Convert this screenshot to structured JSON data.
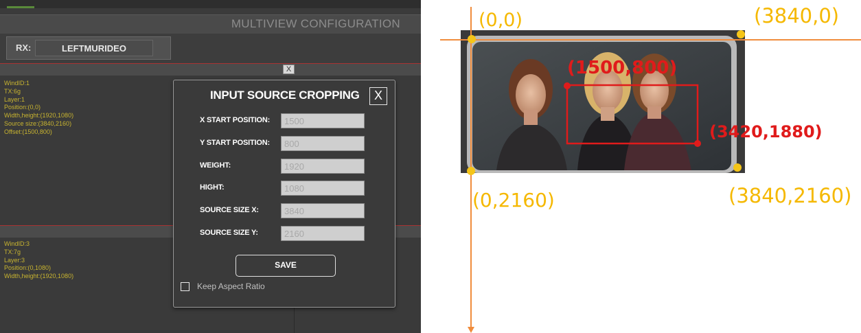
{
  "app": {
    "title": "MULTIVIEW CONFIGURATION",
    "rx_label": "RX:",
    "rx_value": "LEFTMURIDEO",
    "window_close_label": "X",
    "window1": {
      "lines": [
        "WindID:1",
        "TX:6g",
        "Layer:1",
        "Position:(0,0)",
        "Width,height:(1920,1080)",
        "Source size:(3840,2160)",
        "Offset:(1500,800)"
      ]
    },
    "window2": {
      "lines": [
        "WindID:3",
        "TX:7g",
        "Layer:3",
        "Position:(0,1080)",
        "Width,height:(1920,1080)"
      ]
    }
  },
  "dialog": {
    "title": "INPUT SOURCE CROPPING",
    "close_label": "X",
    "fields": [
      {
        "label": "X START POSITION:",
        "value": "1500"
      },
      {
        "label": "Y START POSITION:",
        "value": "800"
      },
      {
        "label": "WEIGHT:",
        "value": "1920"
      },
      {
        "label": "HIGHT:",
        "value": "1080"
      },
      {
        "label": "SOURCE SIZE X:",
        "value": "3840"
      },
      {
        "label": "SOURCE SIZE Y:",
        "value": "2160"
      }
    ],
    "save_label": "SAVE",
    "keep_aspect_label": "Keep Aspect Ratio",
    "keep_aspect_checked": false
  },
  "illustration": {
    "corner_top_left": "(0,0)",
    "corner_top_right": "(3840,0)",
    "corner_bottom_left": "(0,2160)",
    "corner_bottom_right": "(3840,2160)",
    "crop_start": "(1500,800)",
    "crop_end": "(3420,1880)",
    "colors": {
      "axis": "#f08c3c",
      "corner_dot": "#f5c518",
      "crop": "#e01b1b",
      "frame": "#3a3a3a"
    }
  }
}
